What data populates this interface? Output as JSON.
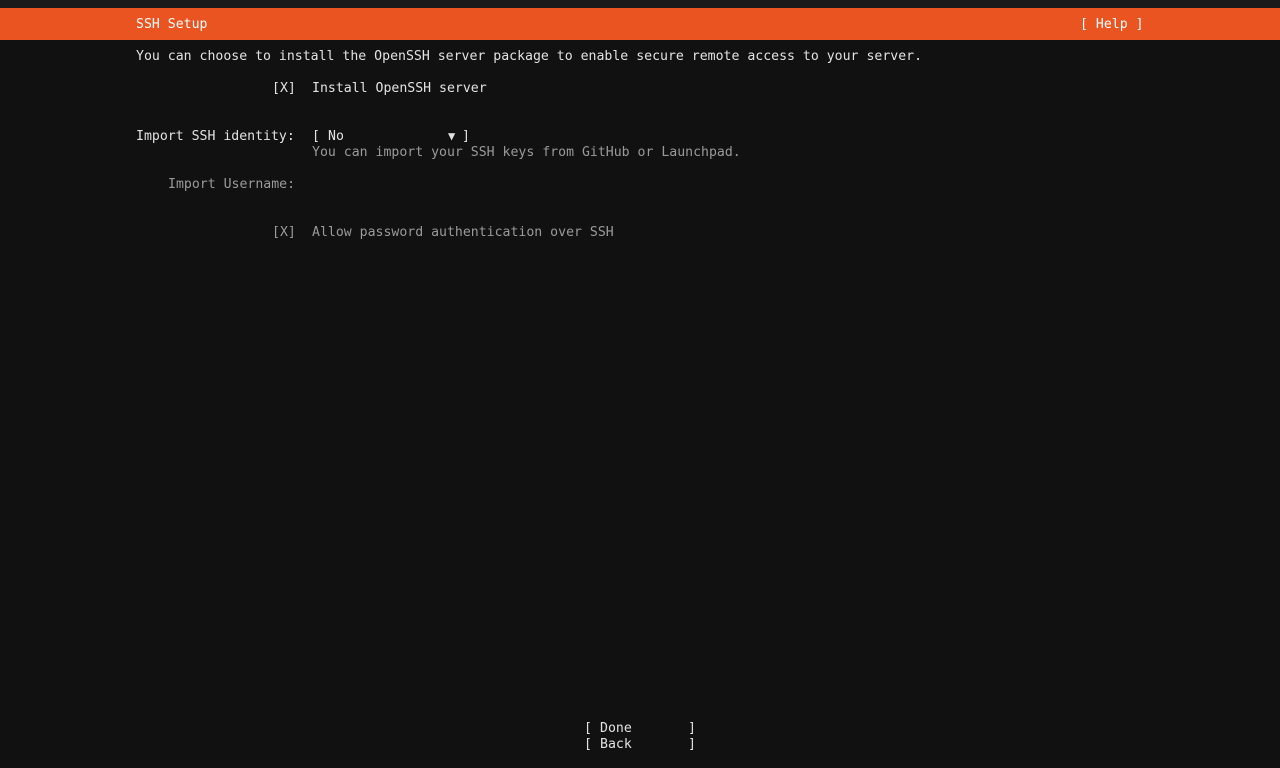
{
  "header": {
    "title": "SSH Setup",
    "help_label": "[ Help ]"
  },
  "intro": "You can choose to install the OpenSSH server package to enable secure remote access to your server.",
  "install_openssh": {
    "checkbox": "[X]",
    "label": "Install OpenSSH server"
  },
  "import_identity": {
    "label": "Import SSH identity:",
    "open_bracket": "[",
    "value": "No",
    "arrow": "▼",
    "close_bracket": "]",
    "hint": "You can import your SSH keys from GitHub or Launchpad."
  },
  "import_username": {
    "label": "Import Username:",
    "value": ""
  },
  "allow_password": {
    "checkbox": "[X]",
    "label": "Allow password authentication over SSH"
  },
  "buttons": {
    "done": {
      "open": "[",
      "label": "Done",
      "close": "]"
    },
    "back": {
      "open": "[",
      "label": "Back",
      "close": "]"
    }
  }
}
